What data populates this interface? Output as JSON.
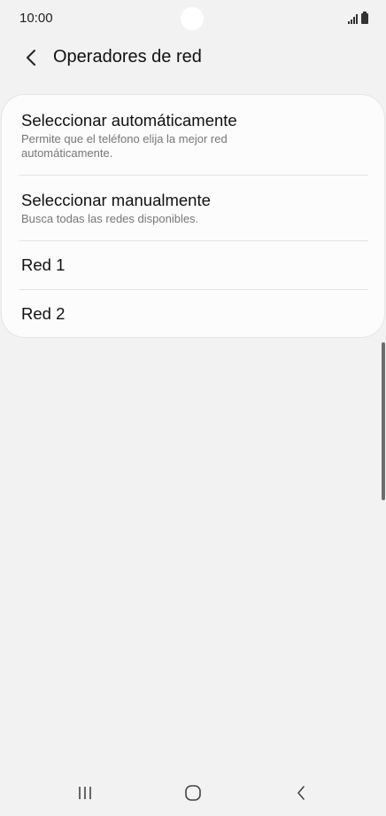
{
  "status_bar": {
    "time": "10:00"
  },
  "header": {
    "title": "Operadores de red",
    "back_icon": "chevron-left-icon"
  },
  "options": [
    {
      "title": "Seleccionar automáticamente",
      "subtitle": "Permite que el teléfono elija la mejor red automáticamente."
    },
    {
      "title": "Seleccionar manualmente",
      "subtitle": "Busca todas las redes disponibles."
    },
    {
      "title": "Red 1"
    },
    {
      "title": "Red 2"
    }
  ],
  "nav_bar": {
    "recents_icon": "recents-icon",
    "home_icon": "home-icon",
    "back_icon": "back-icon"
  },
  "colors": {
    "background": "#f2f2f2",
    "card": "#fcfcfc",
    "divider": "#e3e3e3",
    "subtitle": "#777777"
  }
}
